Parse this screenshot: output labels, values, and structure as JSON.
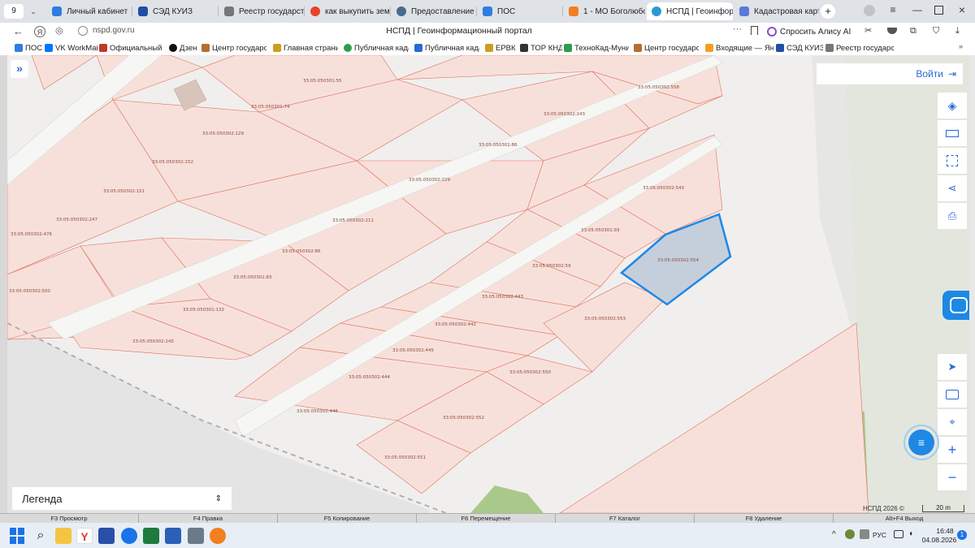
{
  "browser": {
    "tab_count": "9",
    "tabs": [
      {
        "label": "Личный кабинет",
        "color": "#2f7de1"
      },
      {
        "label": "СЭД КУИЗ",
        "color": "#1f4fa8"
      },
      {
        "label": "Реестр государстве",
        "color": "#777777"
      },
      {
        "label": "как выкупить земел",
        "color": "#e8412a"
      },
      {
        "label": "Предоставление св",
        "color": "#4a6a8a"
      },
      {
        "label": "ПОС",
        "color": "#2f7de1"
      },
      {
        "label": "1 - МО Боголюбовск",
        "color": "#f08020"
      },
      {
        "label": "НСПД | Геоинфор",
        "color": "#2a9ad0"
      },
      {
        "label": "Кадастровая карта",
        "color": "#5a7ad8"
      }
    ],
    "close_glyph": "×",
    "new_tab_glyph": "+",
    "url": "nspd.gov.ru",
    "page_title": "НСПД | Геоинформационный портал",
    "alice_label": "Спросить Алису AI",
    "more_glyph": "···"
  },
  "bookmarks": [
    {
      "label": "ПОС",
      "color": "#2f7de1"
    },
    {
      "label": "VK WorkMail",
      "color": "#0077ff"
    },
    {
      "label": "Официальный са",
      "color": "#c0392b"
    },
    {
      "label": "Дзен",
      "color": "#111111"
    },
    {
      "label": "Центр государств",
      "color": "#b07030"
    },
    {
      "label": "Главная страниц",
      "color": "#c8a020"
    },
    {
      "label": "Публичная кадас",
      "color": "#2e9e4a"
    },
    {
      "label": "Публичная кадас",
      "color": "#2a6ad4"
    },
    {
      "label": "ЕРВК",
      "color": "#c8a020"
    },
    {
      "label": "ТОР КНД",
      "color": "#333333"
    },
    {
      "label": "ТехноКад-Муници",
      "color": "#2e9e4a"
    },
    {
      "label": "Центр государств",
      "color": "#b07030"
    },
    {
      "label": "Входящие — Янд",
      "color": "#f0a020"
    },
    {
      "label": "СЭД КУИЗ",
      "color": "#1f4fa8"
    },
    {
      "label": "Реестр государст",
      "color": "#777777"
    }
  ],
  "map": {
    "login_label": "Войти",
    "expand_glyph": "»",
    "legend_label": "Легенда",
    "zoom_in_glyph": "+",
    "zoom_out_glyph": "−",
    "copyright": "НСПД 2026 ©",
    "scale_label": "20 m",
    "selected_color": "#1e88e5",
    "accent_color": "#2a6ad4",
    "parcel_labels": [
      "33:05:050301:55",
      "33:05:050301:74",
      "33:05:050302:129",
      "33:05:050302:152",
      "33:05:050302:151",
      "33:05:050302:247",
      "33:05:050302:476",
      "33:05:050302:500",
      "33:05:050302:558",
      "33:05:050302:243",
      "33:05:050301:86",
      "33:05:050302:229",
      "33:05:050302:211",
      "33:05:050302:86",
      "33:05:050301:83",
      "33:05:050301:132",
      "33:05:050302:245",
      "33:05:050302:543",
      "33:05:050301:93",
      "33:05:050302:59",
      "33:05:050302:554",
      "33:05:050302:443",
      "33:05:050302:442",
      "33:05:050302:553",
      "33:05:050302:445",
      "33:05:050302:444",
      "33:05:050302:550",
      "33:05:050302:446",
      "33:05:050302:552",
      "33:05:050302:551"
    ]
  },
  "fkeys": [
    "F3 Просмотр",
    "F4 Правка",
    "F5 Копирование",
    "F6 Перемещение",
    "F7 Каталог",
    "F8 Удаление",
    "Alt+F4 Выход"
  ],
  "taskbar": {
    "lang": "РУС",
    "time": "16:48",
    "date": "04.08.2026",
    "notif_count": "1"
  }
}
